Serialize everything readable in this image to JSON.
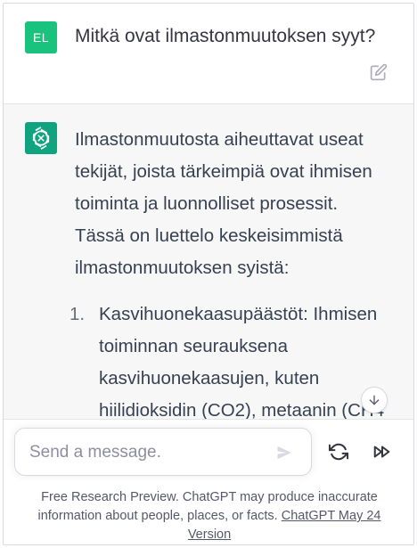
{
  "user_message": {
    "avatar_initials": "EL",
    "avatar_color": "#19c37d",
    "text": "Mitkä ovat ilmastonmuutoksen syyt?",
    "edit_icon": "edit-icon"
  },
  "assistant_message": {
    "avatar_icon": "openai-logo-icon",
    "avatar_color": "#10a37f",
    "intro": "Ilmastonmuutosta aiheuttavat useat tekijät, joista tärkeimpiä ovat ihmisen toiminta ja luonnolliset prosessit. Tässä on luettelo keskeisimmistä ilmastonmuutoksen syistä:",
    "list": [
      {
        "number": "1.",
        "text": "Kasvihuonekaasupäästöt: Ihmisen toiminnan seurauksena kasvihuonekaasujen, kuten hiilidioksidin (CO2), metaanin (CH4"
      }
    ]
  },
  "composer": {
    "placeholder": "Send a message.",
    "send_icon": "send-icon",
    "regenerate_icon": "regenerate-icon",
    "continue_icon": "fast-forward-icon",
    "scroll_icon": "arrow-down-icon"
  },
  "footer": {
    "text": "Free Research Preview. ChatGPT may produce inaccurate information about people, places, or facts. ",
    "link_text": "ChatGPT May 24 Version"
  }
}
